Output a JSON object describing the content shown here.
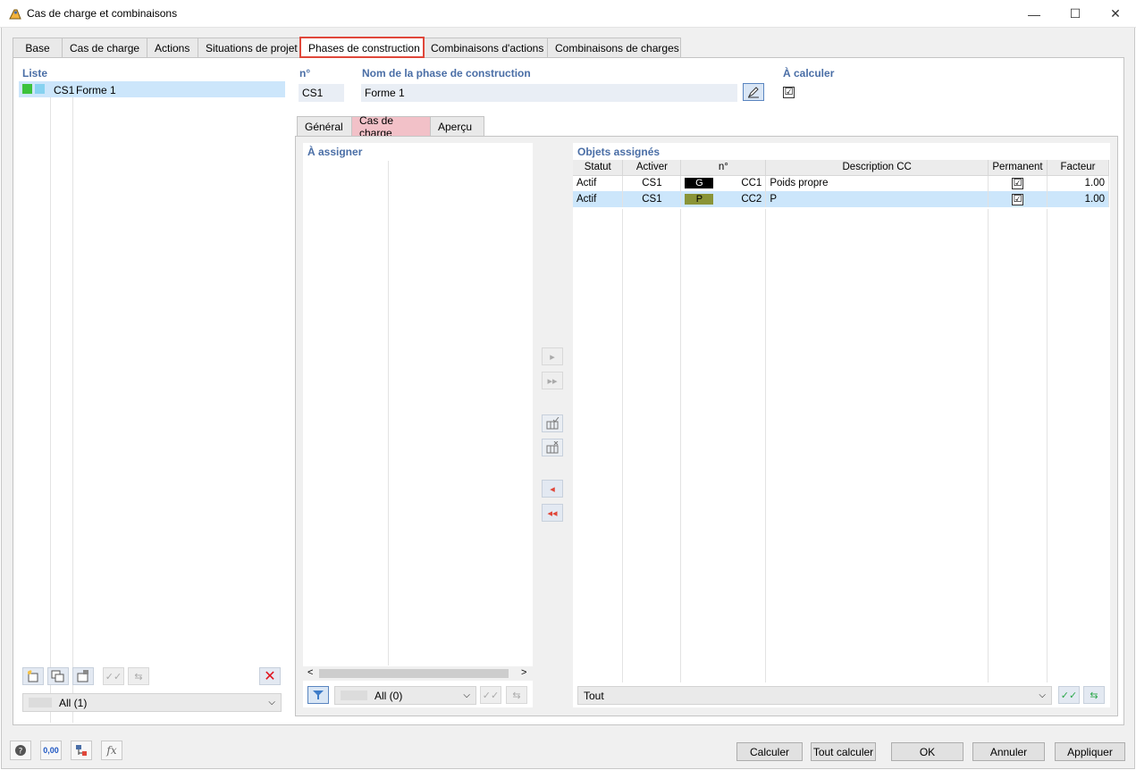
{
  "window": {
    "title": "Cas de charge et combinaisons",
    "minimize": "—",
    "maximize": "☐",
    "close": "✕"
  },
  "tabs": [
    {
      "label": "Base"
    },
    {
      "label": "Cas de charge"
    },
    {
      "label": "Actions"
    },
    {
      "label": "Situations de projet"
    },
    {
      "label": "Phases de construction",
      "active": true
    },
    {
      "label": "Combinaisons d'actions"
    },
    {
      "label": "Combinaisons de charges"
    }
  ],
  "list": {
    "header": "Liste",
    "items": [
      {
        "id": "CS1",
        "name": "Forme 1",
        "colors": [
          "#3cc23c",
          "#86d2f0"
        ]
      }
    ],
    "filter": "All (1)"
  },
  "header_fields": {
    "no_label": "n°",
    "no_value": "CS1",
    "name_label": "Nom de la phase de construction",
    "name_value": "Forme 1",
    "calc_label": "À calculer",
    "calc_checked": "☑"
  },
  "inner_tabs": [
    {
      "label": "Général"
    },
    {
      "label": "Cas de charge",
      "active": true
    },
    {
      "label": "Aperçu"
    }
  ],
  "to_assign": {
    "header": "À assigner",
    "filter": "All (0)"
  },
  "assigned": {
    "header": "Objets assignés",
    "columns": [
      "Statut",
      "Activer",
      "n°",
      "Description CC",
      "Permanent",
      "Facteur"
    ],
    "rows": [
      {
        "statut": "Actif",
        "activer": "CS1",
        "tag": "G",
        "tag_color": "#000000",
        "tag_text_color": "#ffffff",
        "no": "CC1",
        "desc": "Poids propre",
        "perm": "☑",
        "factor": "1.00"
      },
      {
        "statut": "Actif",
        "activer": "CS1",
        "tag": "P",
        "tag_color": "#8a9437",
        "tag_text_color": "#000000",
        "no": "CC2",
        "desc": "P",
        "perm": "☑",
        "factor": "1.00"
      }
    ],
    "filter": "Tout"
  },
  "footer": {
    "calculate": "Calculer",
    "calculate_all": "Tout calculer",
    "ok": "OK",
    "cancel": "Annuler",
    "apply": "Appliquer",
    "number_icon_text": "0,00"
  },
  "colors": {
    "accent_red": "#e0473a",
    "section_blue": "#4a6ea6",
    "selection": "#cce6fb",
    "active_inner_tab": "#f2c1c8"
  }
}
